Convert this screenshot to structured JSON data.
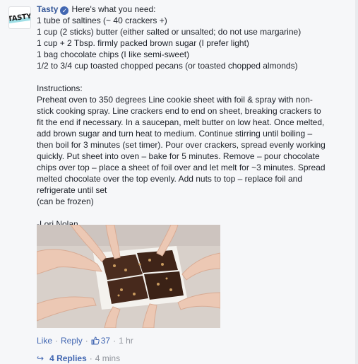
{
  "comment": {
    "author": "Tasty",
    "verified_icon": "verified-badge-icon",
    "avatar_text": "TASTY",
    "heading": "Here's what you need:",
    "ingredients": [
      "1 tube of saltines (~ 40 crackers +)",
      "1 cup (2 sticks) butter (either salted or unsalted; do not use margarine)",
      "1 cup + 2 Tbsp. firmly packed brown sugar (I prefer light)",
      "1 bag chocolate chips (I like semi-sweet)",
      "1/2 to 3/4 cup toasted chopped pecans (or toasted chopped almonds)"
    ],
    "instructions_title": "Instructions:",
    "instructions_text": "Preheat oven to 350 degrees Line cookie sheet with foil & spray with non-stick cooking spray. Line crackers end to end on sheet, breaking crackers to fit the end if necessary. In a saucepan, melt butter on low heat. Once melted, add brown sugar and turn heat to medium. Continue stirring until boiling – then boil for 3 minutes (set timer). Pour over crackers, spread evenly working quickly. Put sheet into oven – bake for 5 minutes. Remove – pour chocolate chips over top – place a sheet of foil over and let melt for ~3 minutes. Spread melted chocolate over the top evenly. Add nuts to top – replace foil and refrigerate until set",
    "frozen_note": "(can be frozen)",
    "signature": "-Lori Nolan"
  },
  "actions": {
    "like": "Like",
    "reply": "Reply",
    "like_count": "37",
    "time": "1 hr"
  },
  "replies": {
    "count_label": "4 Replies",
    "time": "4 mins"
  },
  "colors": {
    "link": "#4267b2",
    "author": "#365899",
    "muted": "#90949c",
    "background": "#f6f7f9"
  }
}
